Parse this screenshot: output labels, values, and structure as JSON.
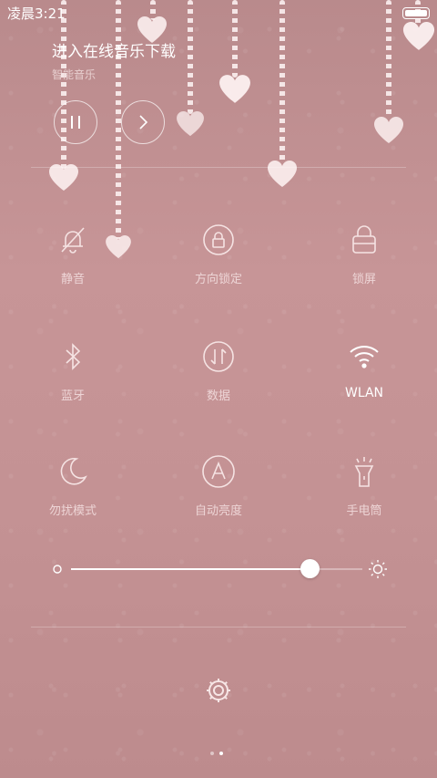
{
  "status_bar": {
    "time": "凌晨3:21",
    "battery_icon": "battery-icon"
  },
  "music": {
    "title": "进入在线音乐下载",
    "app": "智能音乐",
    "pause_icon": "pause-icon",
    "next_icon": "next-icon"
  },
  "tiles": [
    {
      "label": "静音",
      "icon": "bell-off-icon",
      "active": false
    },
    {
      "label": "方向锁定",
      "icon": "rotation-lock-icon",
      "active": false
    },
    {
      "label": "锁屏",
      "icon": "lock-icon",
      "active": false
    },
    {
      "label": "蓝牙",
      "icon": "bluetooth-icon",
      "active": false
    },
    {
      "label": "数据",
      "icon": "mobile-data-icon",
      "active": false
    },
    {
      "label": "WLAN",
      "icon": "wifi-icon",
      "active": true
    },
    {
      "label": "勿扰模式",
      "icon": "moon-icon",
      "active": false
    },
    {
      "label": "自动亮度",
      "icon": "auto-brightness-icon",
      "active": false
    },
    {
      "label": "手电筒",
      "icon": "flashlight-icon",
      "active": false
    }
  ],
  "brightness": {
    "level": 0.82,
    "min_icon": "brightness-low-icon",
    "max_icon": "brightness-high-icon"
  },
  "settings_icon": "gear-icon",
  "page_indicator": {
    "count": 2,
    "current": 2
  },
  "colors": {
    "background": "#c49294",
    "accent": "#ffffff"
  }
}
